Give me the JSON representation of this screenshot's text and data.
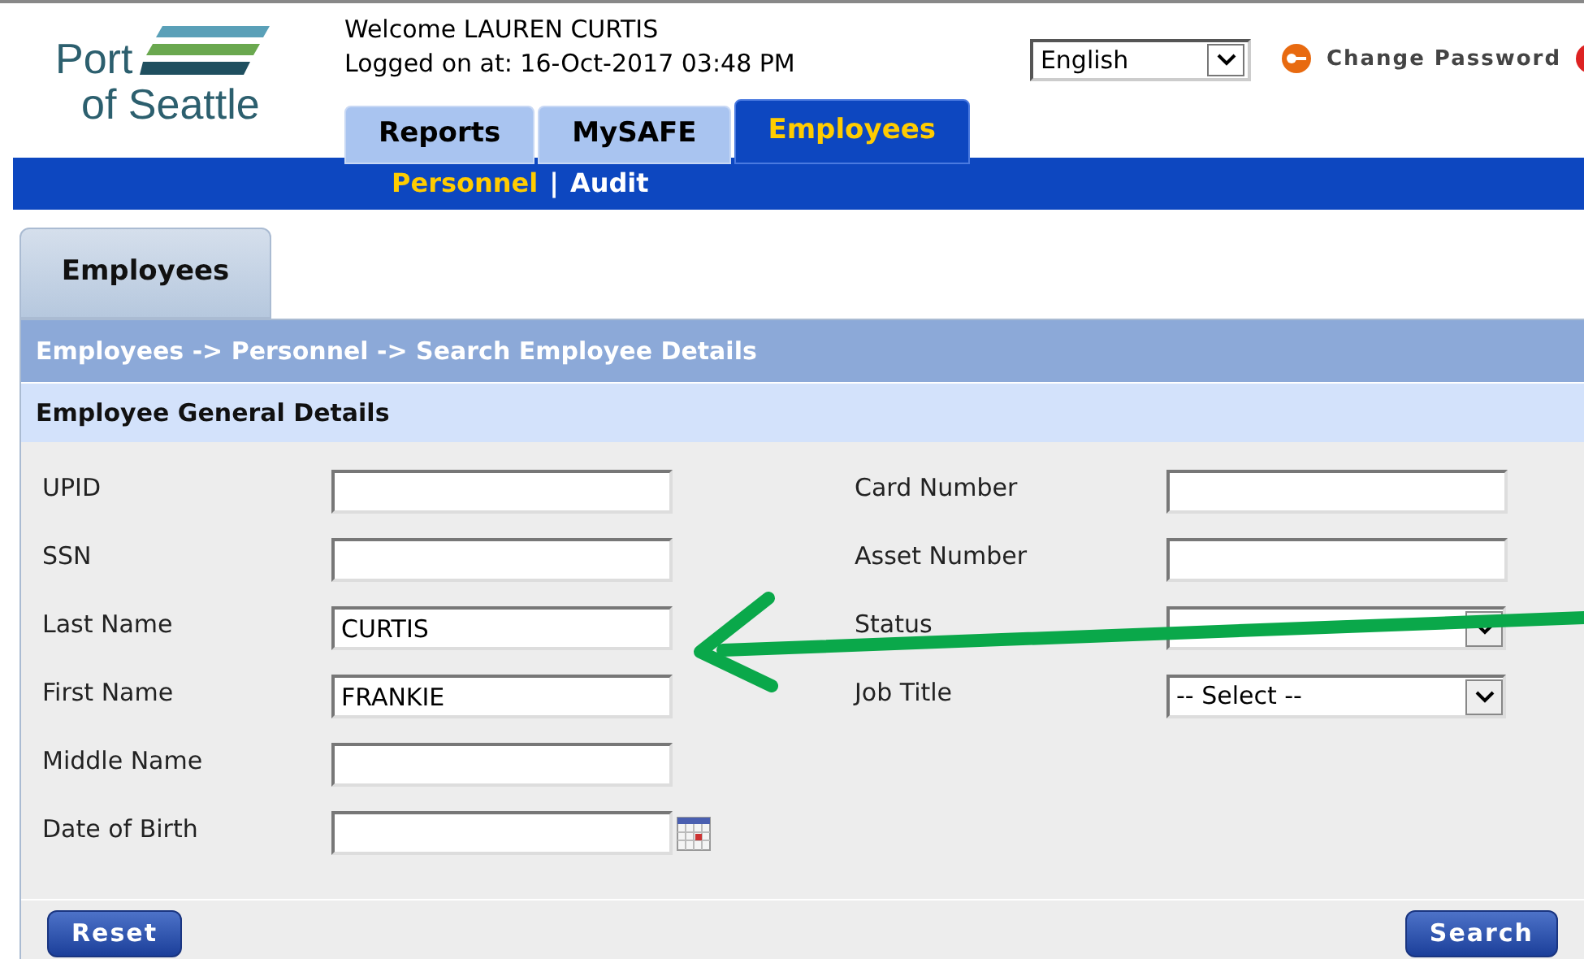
{
  "header": {
    "welcome": "Welcome LAUREN CURTIS",
    "logged_on": "Logged on at: 16-Oct-2017 03:48 PM",
    "language": "English",
    "change_password": "Change Password"
  },
  "logo": {
    "line1": "Port",
    "line2": "of Seattle"
  },
  "tabs": [
    {
      "label": "Reports",
      "selected": false
    },
    {
      "label": "MySAFE",
      "selected": false
    },
    {
      "label": "Employees",
      "selected": true
    }
  ],
  "subnav": [
    {
      "label": "Personnel",
      "selected": true
    },
    {
      "label": "Audit",
      "selected": false
    }
  ],
  "subnav_separator": "|",
  "page_tab": "Employees",
  "breadcrumb": "Employees -> Personnel -> Search Employee Details",
  "section_title": "Employee General Details",
  "left_fields": [
    {
      "label": "UPID",
      "kind": "text"
    },
    {
      "label": "SSN",
      "kind": "text"
    },
    {
      "label": "Last Name",
      "kind": "text",
      "value": "CURTIS"
    },
    {
      "label": "First Name",
      "kind": "text",
      "value": "FRANKIE"
    },
    {
      "label": "Middle Name",
      "kind": "text"
    },
    {
      "label": "Date of Birth",
      "kind": "date"
    }
  ],
  "right_fields": [
    {
      "label": "Card Number",
      "kind": "text"
    },
    {
      "label": "Asset Number",
      "kind": "text"
    },
    {
      "label": "Status",
      "kind": "select"
    },
    {
      "label": "Job Title",
      "kind": "select",
      "value": "-- Select --"
    }
  ],
  "buttons": [
    {
      "label": "Reset"
    },
    {
      "label": "Search"
    }
  ],
  "annotation": {
    "kind": "arrow"
  }
}
